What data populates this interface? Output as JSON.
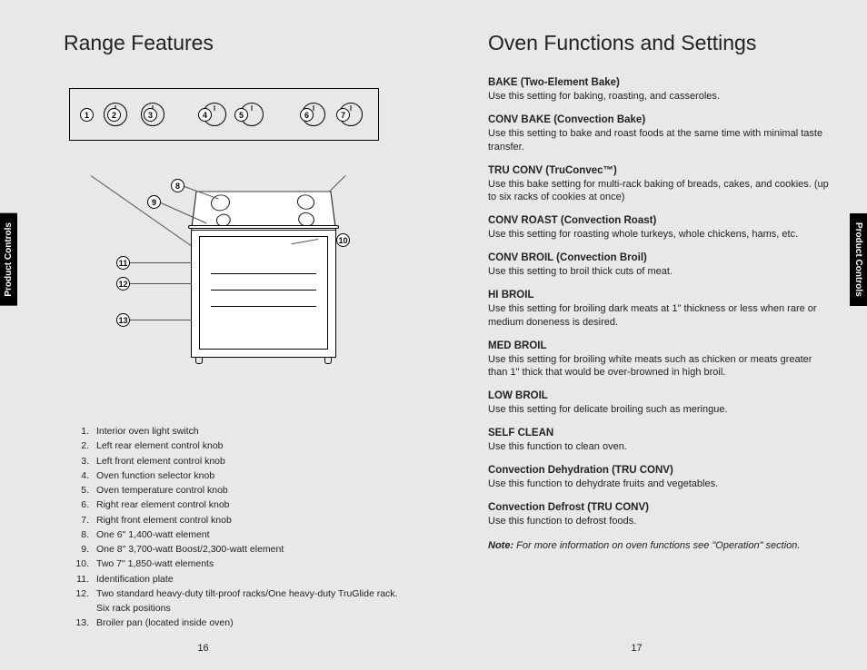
{
  "leftTab": "Product Controls",
  "rightTab": "Product Controls",
  "leftPage": {
    "title": "Range Features",
    "pageNumber": "16",
    "features": [
      {
        "n": "1.",
        "t": "Interior oven light switch"
      },
      {
        "n": "2.",
        "t": "Left rear element control knob"
      },
      {
        "n": "3.",
        "t": "Left front element control knob"
      },
      {
        "n": "4.",
        "t": "Oven function selector knob"
      },
      {
        "n": "5.",
        "t": "Oven temperature control knob"
      },
      {
        "n": "6.",
        "t": "Right rear element control knob"
      },
      {
        "n": "7.",
        "t": "Right front element control knob"
      },
      {
        "n": "8.",
        "t": "One 6\" 1,400-watt element"
      },
      {
        "n": "9.",
        "t": "One 8\" 3,700-watt Boost/2,300-watt element"
      },
      {
        "n": "10.",
        "t": "Two 7\" 1,850-watt elements"
      },
      {
        "n": "11.",
        "t": "Identification plate"
      },
      {
        "n": "12.",
        "t": "Two standard heavy-duty tilt-proof racks/One heavy-duty TruGlide rack. Six rack positions"
      },
      {
        "n": "13.",
        "t": "Broiler pan (located inside oven)"
      }
    ],
    "callouts": [
      "1",
      "2",
      "3",
      "4",
      "5",
      "6",
      "7",
      "8",
      "9",
      "10",
      "11",
      "12",
      "13"
    ]
  },
  "rightPage": {
    "title": "Oven Functions and Settings",
    "pageNumber": "17",
    "sections": [
      {
        "h": "BAKE (Two-Element Bake)",
        "d": "Use this setting for baking, roasting, and casseroles."
      },
      {
        "h": "CONV BAKE (Convection Bake)",
        "d": "Use this setting to bake and roast foods at the same time with minimal taste transfer."
      },
      {
        "h": "TRU CONV (TruConvec™)",
        "d": "Use this bake setting for multi-rack baking of breads, cakes, and cookies. (up to six racks of cookies at once)"
      },
      {
        "h": "CONV ROAST (Convection Roast)",
        "d": "Use this setting for roasting whole turkeys, whole chickens, hams, etc."
      },
      {
        "h": "CONV BROIL (Convection Broil)",
        "d": "Use this setting to broil thick cuts of meat."
      },
      {
        "h": "HI BROIL",
        "d": "Use this setting for broiling dark meats at 1\" thickness or less when rare or medium doneness is desired."
      },
      {
        "h": "MED BROIL",
        "d": "Use this setting for broiling white meats such as chicken or meats greater than 1\" thick that would be over-browned in high broil."
      },
      {
        "h": "LOW BROIL",
        "d": "Use this setting for delicate broiling such as meringue."
      },
      {
        "h": "SELF CLEAN",
        "d": "Use this function to clean oven."
      },
      {
        "h": "Convection Dehydration (TRU CONV)",
        "d": "Use this function to dehydrate fruits and vegetables."
      },
      {
        "h": "Convection Defrost (TRU CONV)",
        "d": "Use this function to defrost foods."
      }
    ],
    "noteLabel": "Note:",
    "noteText": " For more information on oven functions see \"Operation\" section."
  }
}
